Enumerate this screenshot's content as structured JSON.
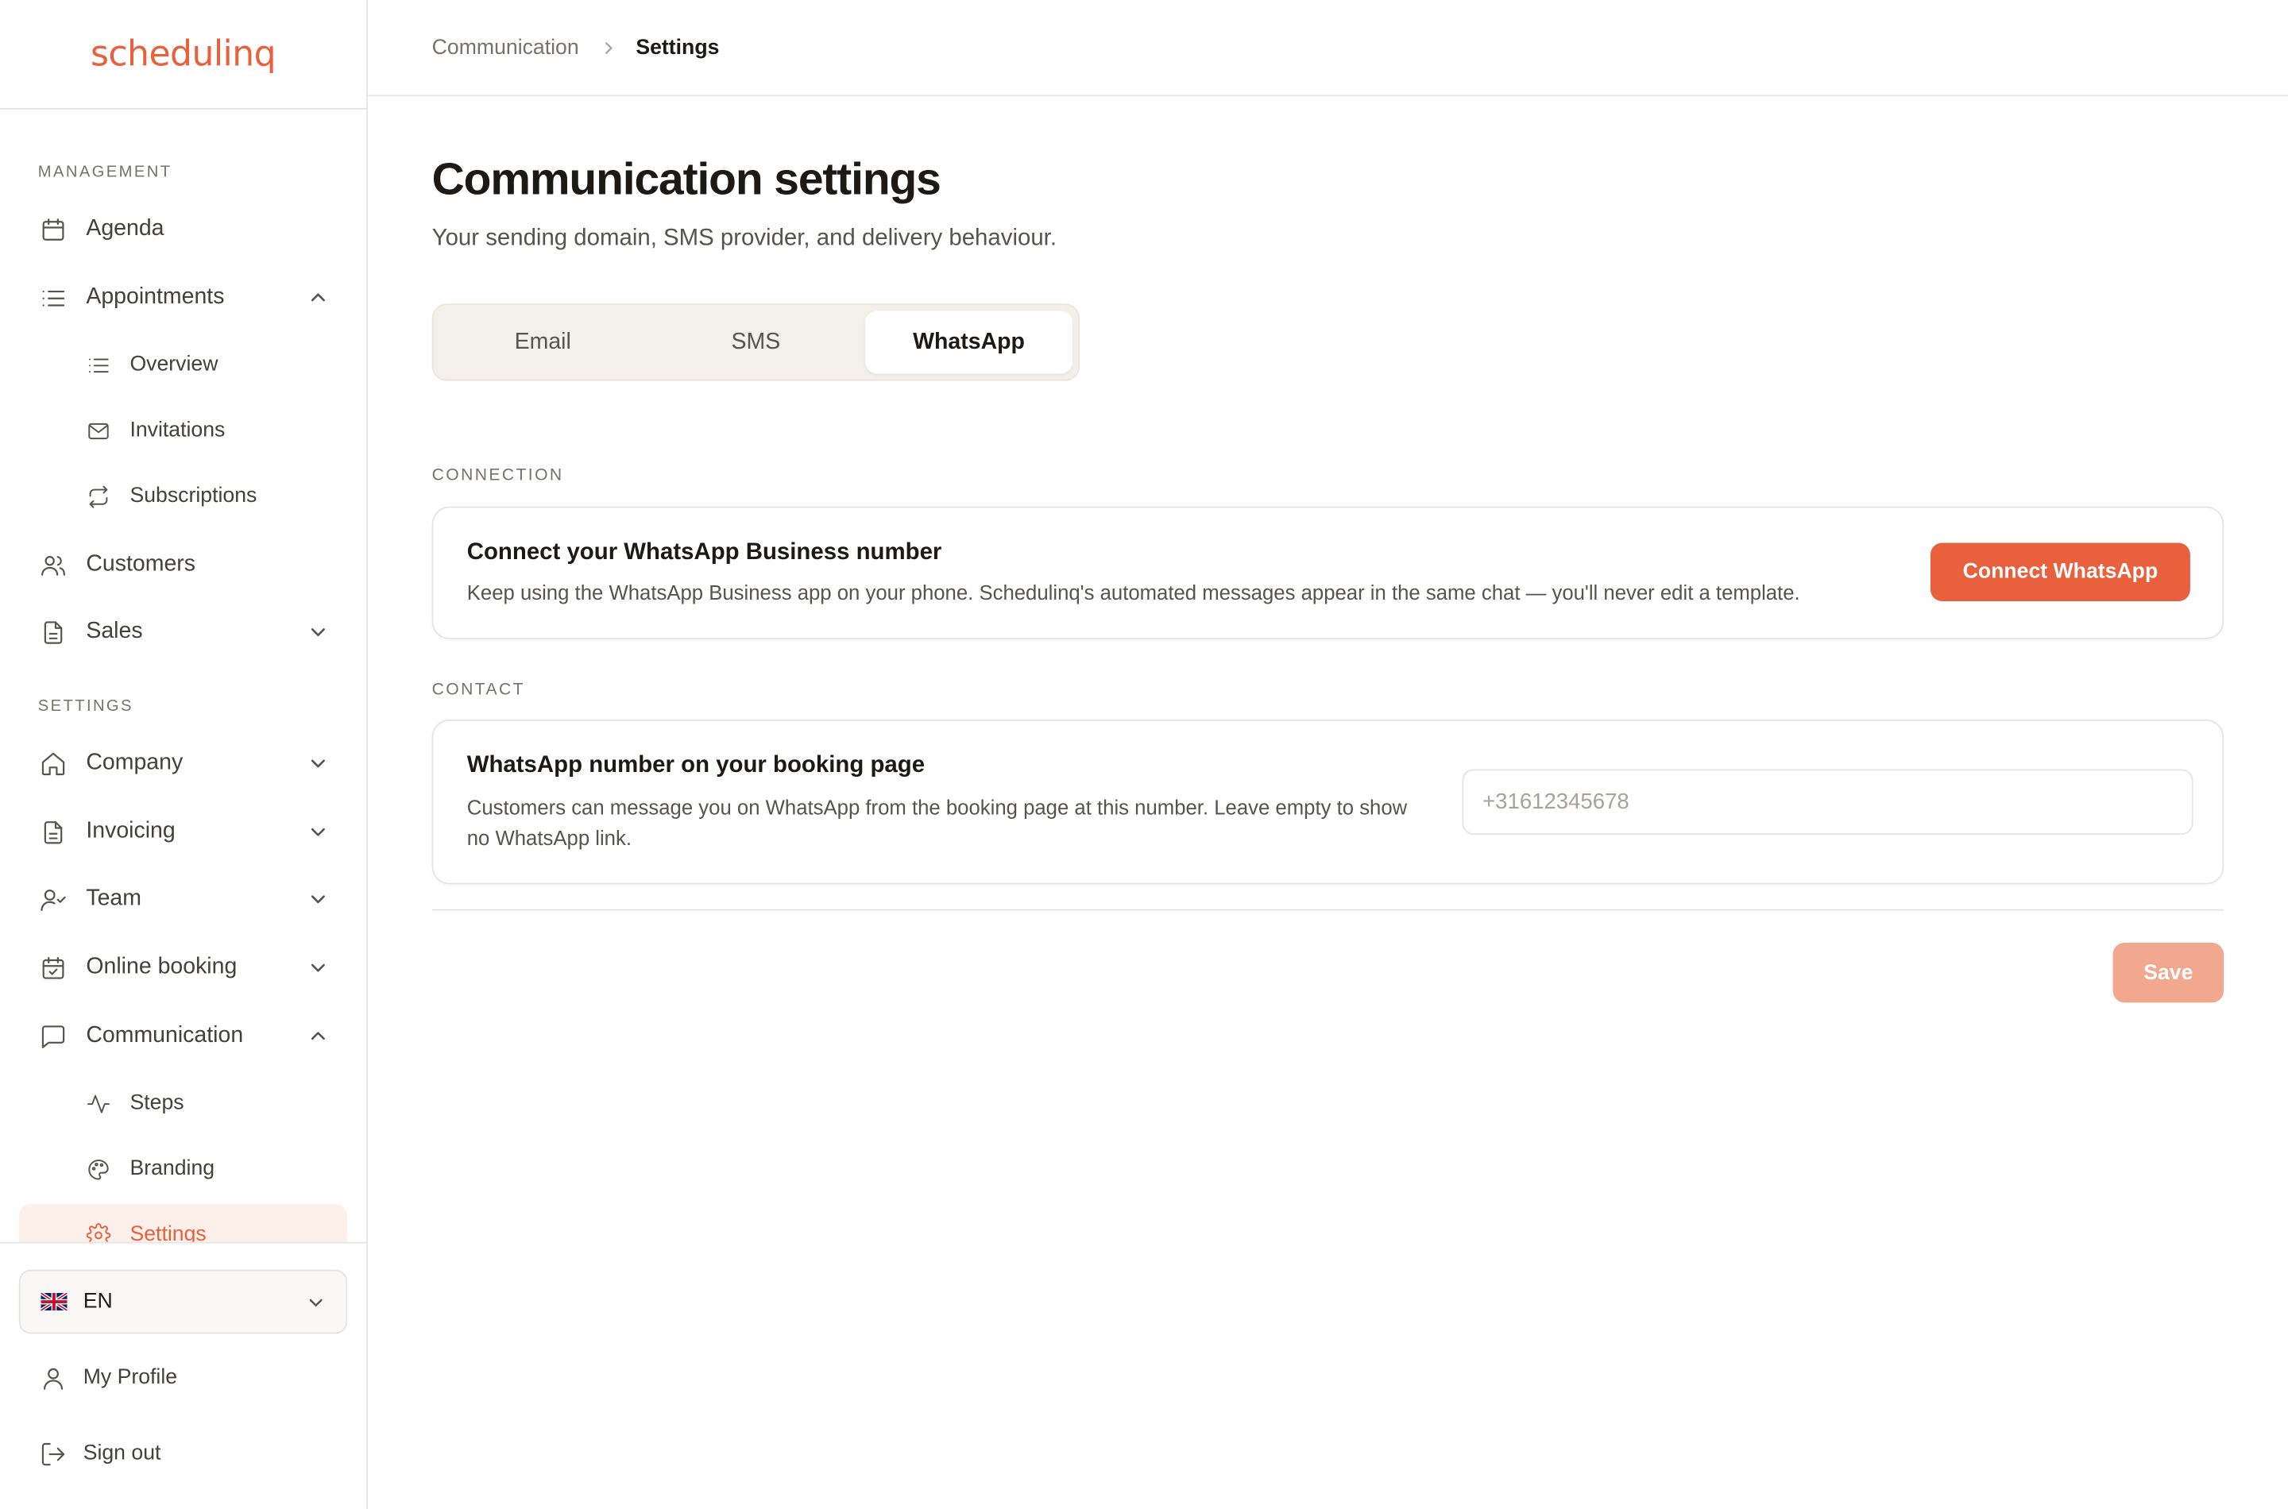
{
  "app": {
    "logo_text": "schedulinq",
    "brand_color": "#e8603c"
  },
  "sidebar": {
    "management_label": "MANAGEMENT",
    "settings_label": "SETTINGS",
    "items": {
      "agenda": "Agenda",
      "appointments": "Appointments",
      "overview": "Overview",
      "invitations": "Invitations",
      "subscriptions": "Subscriptions",
      "customers": "Customers",
      "sales": "Sales",
      "company": "Company",
      "invoicing": "Invoicing",
      "team": "Team",
      "online_booking": "Online booking",
      "communication": "Communication",
      "steps": "Steps",
      "branding": "Branding",
      "settings": "Settings"
    },
    "language": {
      "code": "EN",
      "flag": "uk-flag-icon"
    },
    "my_profile": "My Profile",
    "sign_out": "Sign out"
  },
  "breadcrumb": {
    "parent": "Communication",
    "current": "Settings"
  },
  "page": {
    "title": "Communication settings",
    "subtitle": "Your sending domain, SMS provider, and delivery behaviour."
  },
  "tabs": {
    "email": "Email",
    "sms": "SMS",
    "whatsapp": "WhatsApp",
    "active": "WhatsApp"
  },
  "connection": {
    "label": "CONNECTION",
    "title": "Connect your WhatsApp Business number",
    "description": "Keep using the WhatsApp Business app on your phone. Schedulinq's automated messages appear in the same chat — you'll never edit a template.",
    "button": "Connect WhatsApp"
  },
  "contact": {
    "label": "CONTACT",
    "title": "WhatsApp number on your booking page",
    "description": "Customers can message you on WhatsApp from the booking page at this number. Leave empty to show no WhatsApp link.",
    "input_value": "",
    "input_placeholder": "+31612345678"
  },
  "save_button": "Save"
}
